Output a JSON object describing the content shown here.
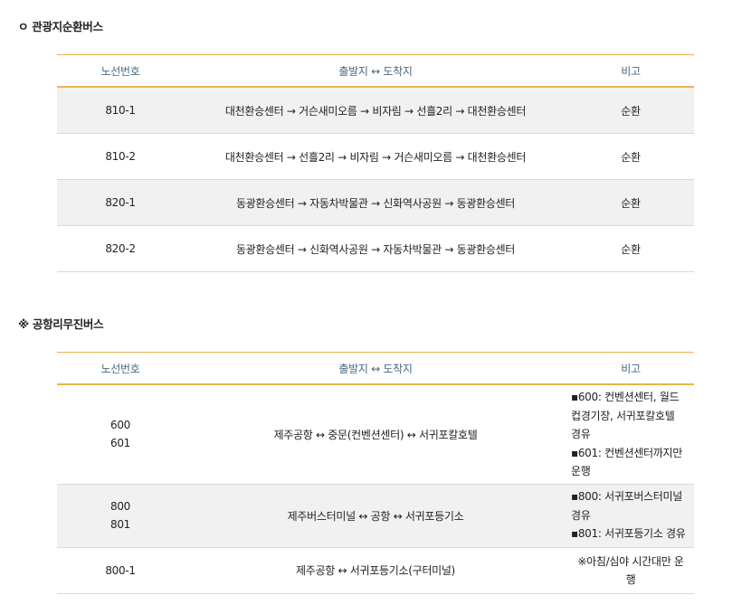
{
  "section1": {
    "title": "ㅇ 관광지순환버스",
    "headers": [
      "노선번호",
      "출발지 ↔ 도착지",
      "비고"
    ],
    "rows": [
      {
        "no": "810-1",
        "route": "대천환승센터 → 거슨새미오름 → 비자림 → 선흘2리 → 대천환승센터",
        "note": "순환"
      },
      {
        "no": "810-2",
        "route": "대천환승센터 → 선흘2리 → 비자림 → 거슨새미오름 → 대천환승센터",
        "note": "순환"
      },
      {
        "no": "820-1",
        "route": "동광환승센터 → 자동차박물관 → 신화역사공원 → 동광환승센터",
        "note": "순환"
      },
      {
        "no": "820-2",
        "route": "동광환승센터 → 신화역사공원 → 자동차박물관 → 동광환승센터",
        "note": "순환"
      }
    ]
  },
  "section2": {
    "title": "※ 공항리무진버스",
    "headers": [
      "노선번호",
      "출발지 ↔ 도착지",
      "비고"
    ],
    "rows": [
      {
        "no": "600\n601",
        "route": "제주공항 ↔ 중문(컨벤션센터) ↔ 서귀포칼호텔",
        "note": "▪600: 컨벤션센터, 월드\n컵경기장, 서귀포칼호텔\n경유\n▪601: 컨벤션센터까지만\n운행"
      },
      {
        "no": "800\n801",
        "route": "제주버스터미널 ↔ 공항 ↔ 서귀포등기소",
        "note": "▪800: 서귀포버스터미널\n경유\n▪801: 서귀포등기소 경유"
      },
      {
        "no": "800-1",
        "route": "제주공항 ↔ 서귀포등기소(구터미널)",
        "note": "※아침/심야 시간대만 운\n행"
      }
    ]
  }
}
